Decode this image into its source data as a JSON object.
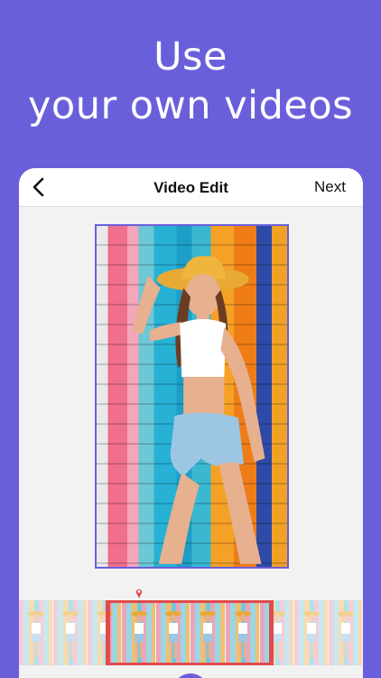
{
  "hero": {
    "line1": "Use",
    "line2": "your own videos"
  },
  "navbar": {
    "back_icon": "chevron-left-icon",
    "title": "Video Edit",
    "next_label": "Next"
  },
  "colors": {
    "background": "#6A5FDB",
    "accent": "#6A5FDB",
    "selection": "#e04b4b",
    "playhead": "#e04b4b"
  },
  "timeline": {
    "frame_count": 10,
    "playhead_icon": "location-pin-icon"
  }
}
